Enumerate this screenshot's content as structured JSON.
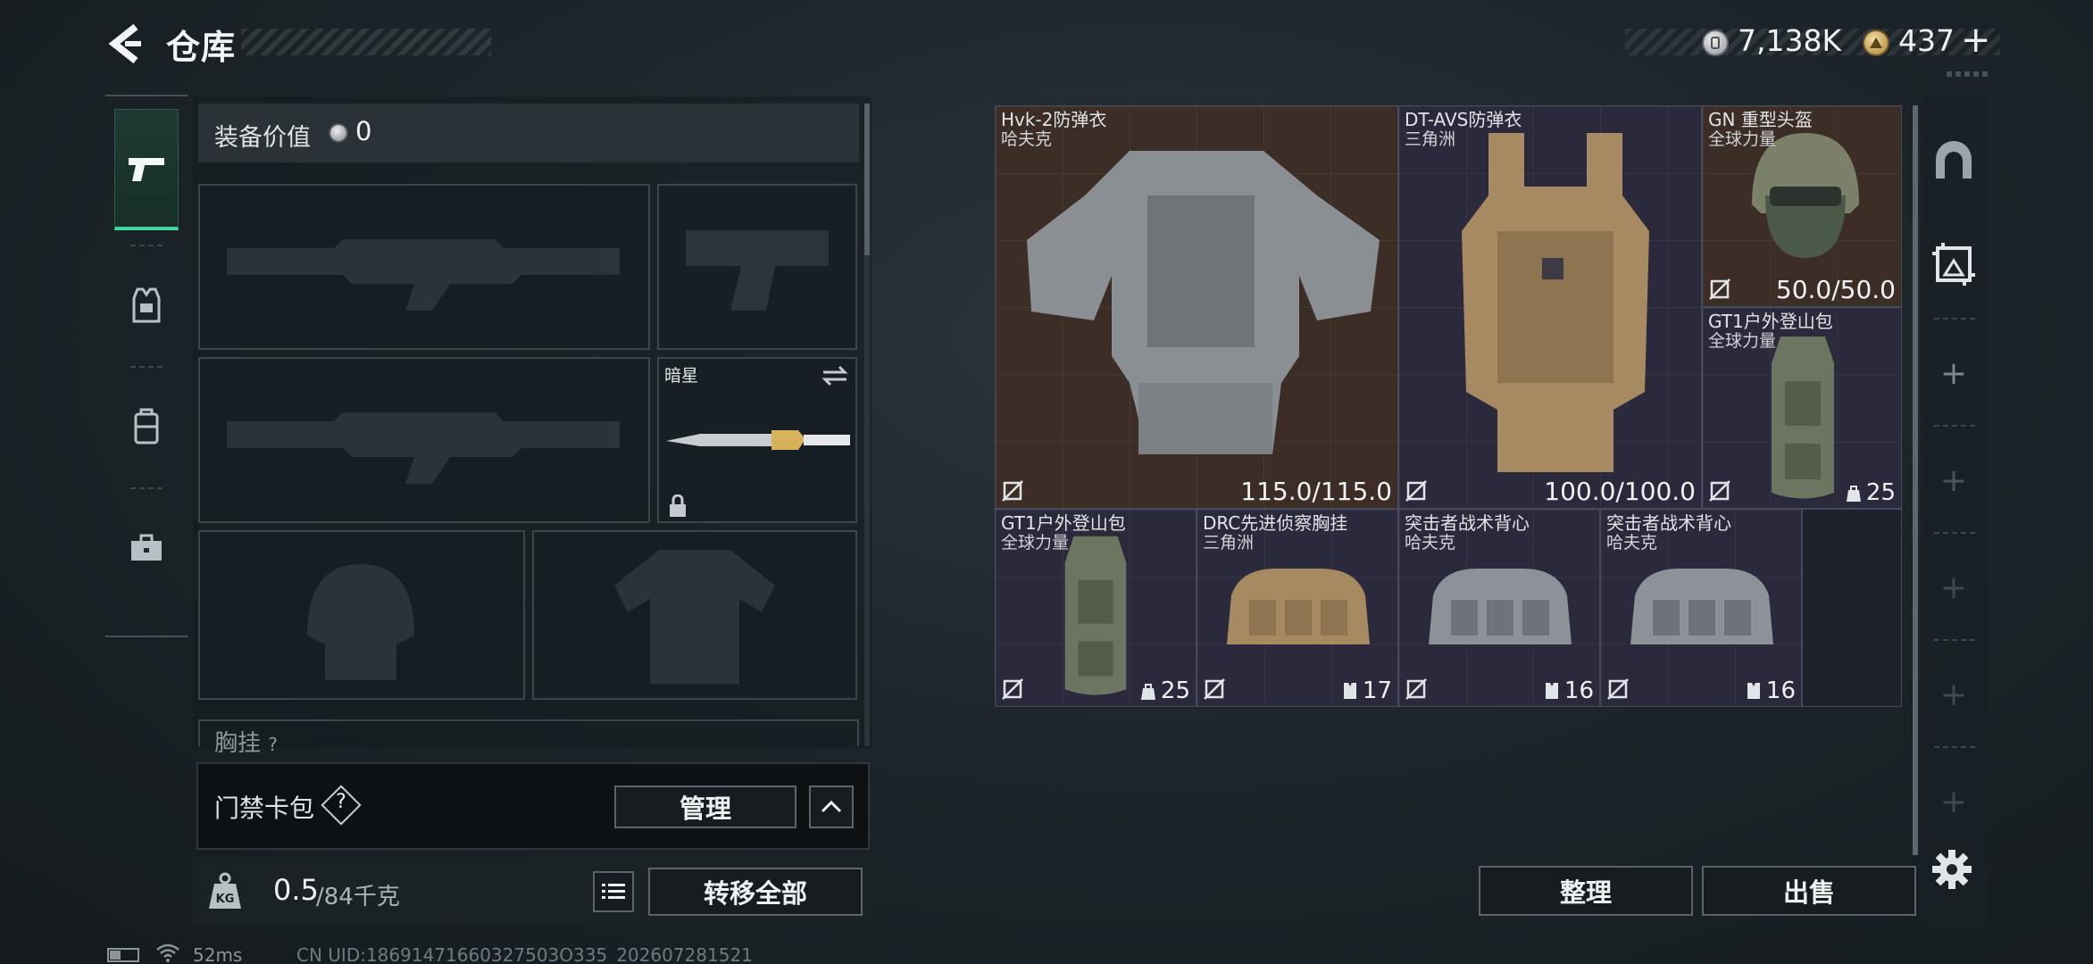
{
  "header": {
    "title": "仓库",
    "currency": {
      "money": "7,138K",
      "premium": "437"
    },
    "add_symbol": "+"
  },
  "tabs": [
    {
      "icon": "pistol-icon",
      "active": true
    },
    {
      "icon": "armor-tab-icon",
      "active": false
    },
    {
      "icon": "backpack-tab-icon",
      "active": false
    },
    {
      "icon": "toolbox-tab-icon",
      "active": false
    }
  ],
  "loadout": {
    "equipment_value_label": "装备价值",
    "equipment_value": "0",
    "melee_name": "暗星",
    "chest_label": "胸挂",
    "chest_help": "?"
  },
  "keycard": {
    "label": "门禁卡包",
    "help": "?",
    "manage": "管理"
  },
  "weight": {
    "current": "0.5",
    "max": "/84千克"
  },
  "actions": {
    "transfer_all": "转移全部",
    "sort": "整理",
    "sell": "出售"
  },
  "storage": {
    "items": [
      {
        "name": "Hvk-2防弹衣",
        "sub": "哈夫克",
        "durability": "115.0/115.0",
        "color": "#3c2e26"
      },
      {
        "name": "DT-AVS防弹衣",
        "sub": "三角洲",
        "durability": "100.0/100.0",
        "color": "#2b2a3c"
      },
      {
        "name": "GN 重型头盔",
        "sub": "全球力量",
        "durability": "50.0/50.0",
        "color": "#3c2e26"
      },
      {
        "name": "GT1户外登山包",
        "sub": "全球力量",
        "count": "25",
        "color": "#2b2a3c"
      },
      {
        "name": "GT1户外登山包",
        "sub": "全球力量",
        "count": "25",
        "color": "#2b2a3c"
      },
      {
        "name": "DRC先进侦察胸挂",
        "sub": "三角洲",
        "count": "17",
        "color": "#2b2a3c"
      },
      {
        "name": "突击者战术背心",
        "sub": "哈夫克",
        "count": "16",
        "color": "#2b2a3c"
      },
      {
        "name": "突击者战术背心",
        "sub": "哈夫克",
        "count": "16",
        "color": "#2b2a3c"
      }
    ]
  },
  "tools": {
    "plus": "+"
  },
  "footer": {
    "ping": "52ms",
    "uid": "CN UID:18691471660327503O335_202607281521"
  }
}
